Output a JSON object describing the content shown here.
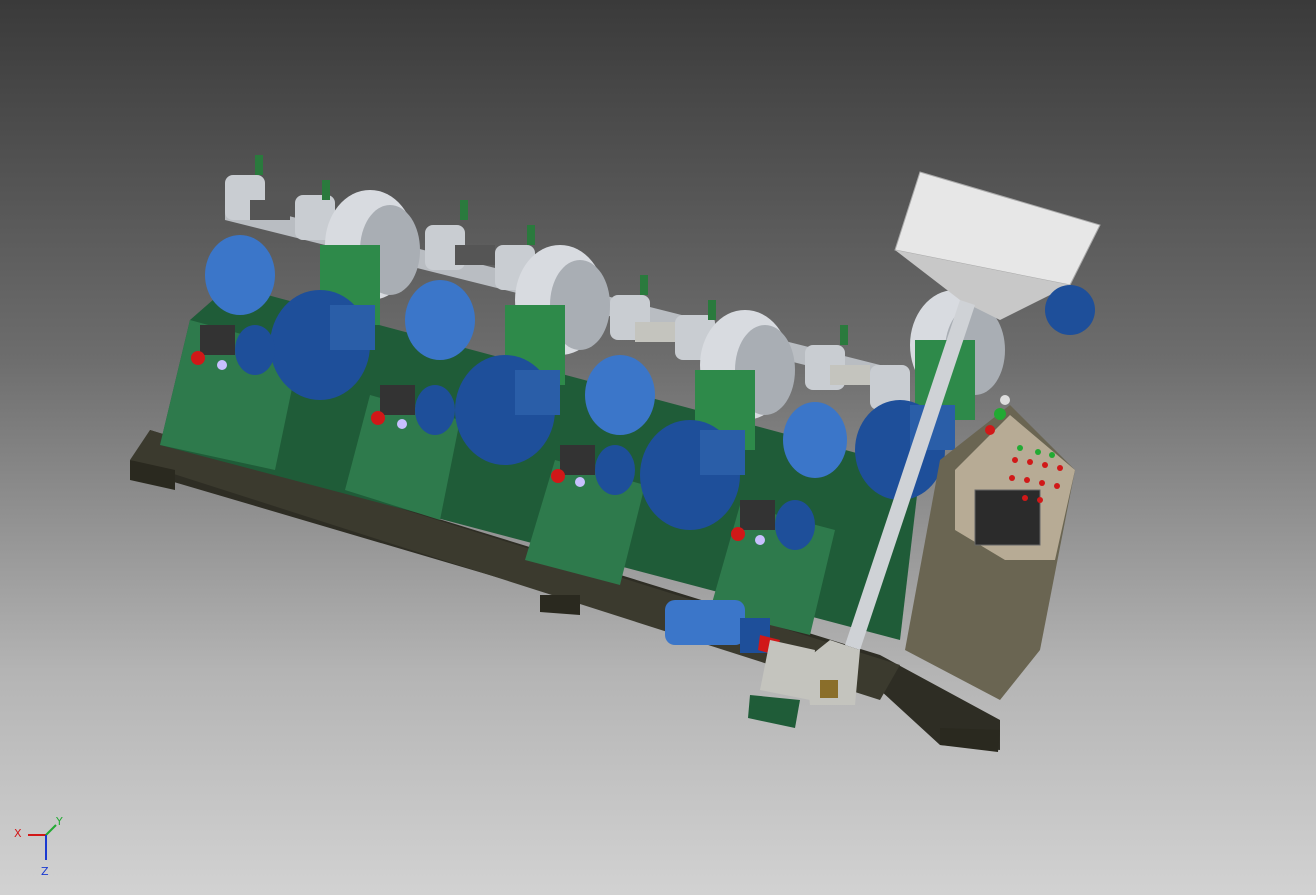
{
  "scene": {
    "subject": "cad-machine-assembly",
    "background_top": "#3a3a3a",
    "background_bottom": "#d2d2d2",
    "colors": {
      "frame_green": "#1f5c38",
      "frame_green_light": "#2e7a4c",
      "motor_blue": "#1e4f9a",
      "motor_blue_light": "#3b76c9",
      "steel": "#c9cdd2",
      "base_dark": "#3b3a2e",
      "cabinet": "#6a6552",
      "panel_light": "#b7ab95",
      "indicator_red": "#d11818",
      "indicator_green": "#22aa33"
    },
    "mills_count": 4,
    "triad": {
      "x_label": "X",
      "y_label": "Y",
      "z_label": "Z",
      "x_color": "#d11818",
      "y_color": "#22aa33",
      "z_color": "#1a3ad1"
    }
  }
}
